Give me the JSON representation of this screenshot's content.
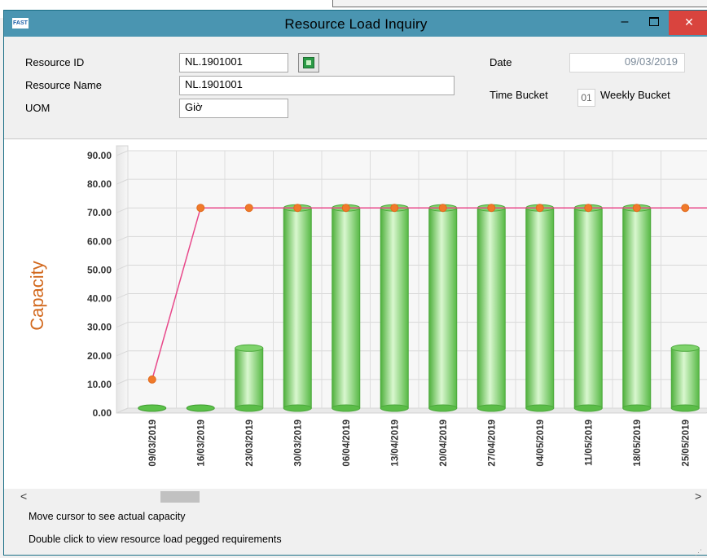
{
  "window": {
    "title": "Resource Load Inquiry",
    "app_icon": "FAST",
    "minimize_glyph": "–",
    "close_glyph": "✕"
  },
  "form": {
    "resource_id_label": "Resource ID",
    "resource_id_value": "NL.1901001",
    "resource_name_label": "Resource Name",
    "resource_name_value": "NL.1901001",
    "uom_label": "UOM",
    "uom_value": "Giờ",
    "date_label": "Date",
    "date_value": "09/03/2019",
    "time_bucket_label": "Time Bucket",
    "time_bucket_code": "01",
    "time_bucket_value": "Weekly Bucket"
  },
  "chart_data": {
    "type": "bar",
    "ylabel": "Capacity",
    "ylim": [
      0,
      90
    ],
    "yticks": [
      "0.00",
      "10.00",
      "20.00",
      "30.00",
      "40.00",
      "50.00",
      "60.00",
      "70.00",
      "80.00",
      "90.00"
    ],
    "categories": [
      "09/03/2019",
      "16/03/2019",
      "23/03/2019",
      "30/03/2019",
      "06/04/2019",
      "13/04/2019",
      "20/04/2019",
      "27/04/2019",
      "04/05/2019",
      "11/05/2019",
      "18/05/2019",
      "25/05/2019"
    ],
    "bar_values": [
      0,
      0,
      21,
      70,
      70,
      70,
      70,
      70,
      70,
      70,
      70,
      21
    ],
    "line_values": [
      10,
      70,
      70,
      70,
      70,
      70,
      70,
      70,
      70,
      70,
      70,
      70
    ],
    "grid": true,
    "colors": {
      "bar": "#5cc24a",
      "line": "#e8488a",
      "marker": "#f07a2a",
      "ylabel": "#d2691e"
    }
  },
  "scrollbar": {
    "left_arrow": "<",
    "right_arrow": ">"
  },
  "status": {
    "hint1": "Move cursor to see actual capacity",
    "hint2": "Double click to view resource load pegged requirements"
  }
}
